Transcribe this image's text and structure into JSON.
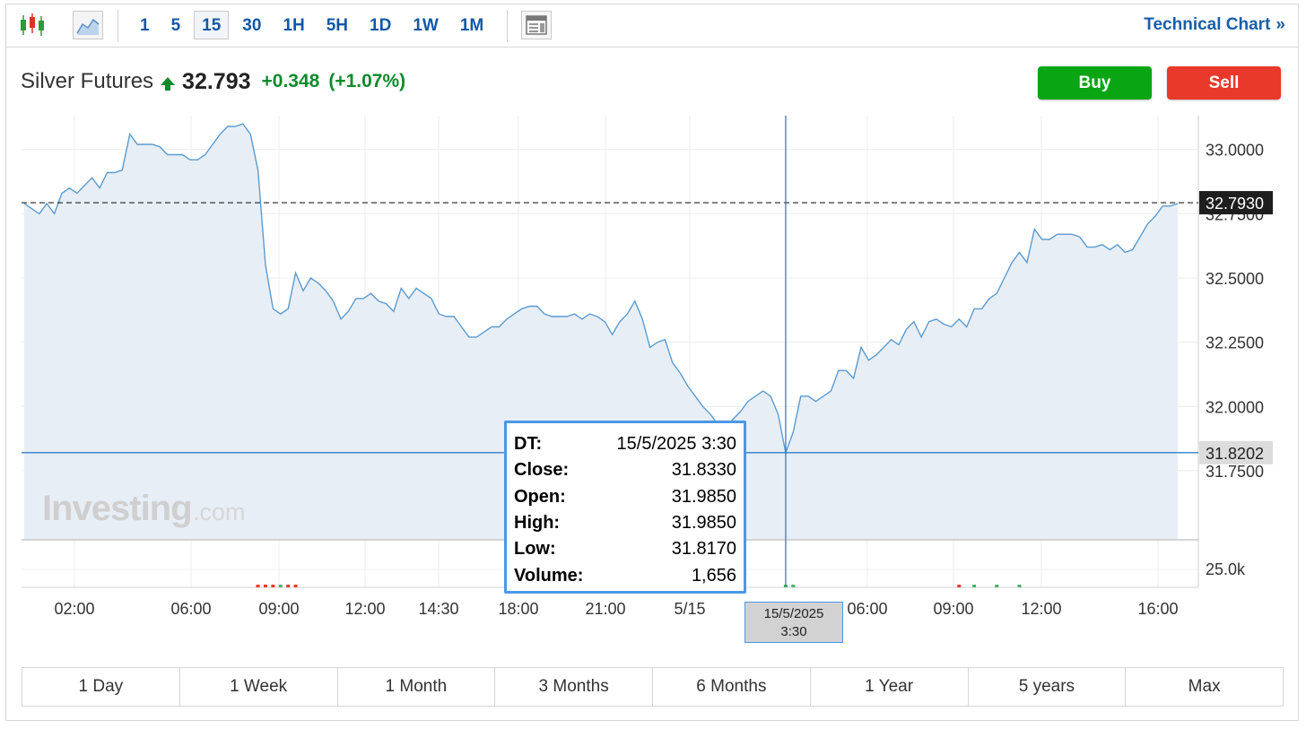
{
  "toolbar": {
    "intervals": [
      "1",
      "5",
      "15",
      "30",
      "1H",
      "5H",
      "1D",
      "1W",
      "1M"
    ],
    "active_interval": "15",
    "technical_chart_label": "Technical Chart",
    "technical_chart_chevron": "»",
    "icons": {
      "candles": "candlestick-icon",
      "area": "area-chart-icon",
      "news": "news-layout-icon"
    }
  },
  "instrument": {
    "name": "Silver Futures",
    "last": "32.793",
    "change": "+0.348",
    "change_pct": "(+1.07%)",
    "direction_icon": "up-arrow-icon"
  },
  "trade": {
    "buy_label": "Buy",
    "sell_label": "Sell"
  },
  "colors": {
    "line": "#5b9bd0",
    "area": "#e8eef6",
    "up": "#0e8a2c",
    "buy": "#0aa513",
    "sell": "#e8392b",
    "link": "#1a5ea8",
    "tooltip_border": "#4c97e9"
  },
  "chart_data": {
    "type": "area",
    "x_labels": [
      "02:00",
      "06:00",
      "09:00",
      "12:00",
      "14:30",
      "18:00",
      "21:00",
      "5/15",
      "06:00",
      "09:00",
      "12:00",
      "16:00"
    ],
    "y_ticks": [
      "33.0000",
      "32.7500",
      "32.5000",
      "32.2500",
      "32.0000",
      "31.7500"
    ],
    "ylim": [
      31.75,
      33.2
    ],
    "volume_tick": "25.0k",
    "last_price_tag": "32.7930",
    "crosshair_price_tag": "31.8202",
    "crosshair_value": 31.8202,
    "last_value": 32.793,
    "crosshair_date": [
      "15/5/2025",
      "3:30"
    ],
    "watermark": {
      "brand": "Investing",
      "suffix": ".com"
    },
    "values": [
      32.79,
      32.77,
      32.75,
      32.79,
      32.75,
      32.83,
      32.85,
      32.83,
      32.86,
      32.89,
      32.85,
      32.91,
      32.91,
      32.92,
      33.06,
      33.02,
      33.02,
      33.02,
      33.01,
      32.98,
      32.98,
      32.98,
      32.96,
      32.96,
      32.98,
      33.02,
      33.06,
      33.09,
      33.09,
      33.1,
      33.06,
      32.92,
      32.55,
      32.38,
      32.36,
      32.38,
      32.52,
      32.45,
      32.5,
      32.48,
      32.45,
      32.41,
      32.34,
      32.37,
      32.42,
      32.42,
      32.44,
      32.41,
      32.4,
      32.37,
      32.46,
      32.42,
      32.46,
      32.44,
      32.42,
      32.36,
      32.35,
      32.35,
      32.31,
      32.27,
      32.27,
      32.29,
      32.31,
      32.31,
      32.34,
      32.36,
      32.38,
      32.39,
      32.39,
      32.36,
      32.35,
      32.35,
      32.35,
      32.36,
      32.34,
      32.36,
      32.35,
      32.33,
      32.28,
      32.33,
      32.36,
      32.41,
      32.34,
      32.23,
      32.25,
      32.26,
      32.17,
      32.13,
      32.08,
      32.04,
      32.0,
      31.97,
      31.93,
      31.92,
      31.95,
      31.98,
      32.02,
      32.04,
      32.06,
      32.04,
      31.97,
      31.82,
      31.9,
      32.04,
      32.04,
      32.02,
      32.04,
      32.06,
      32.14,
      32.14,
      32.11,
      32.23,
      32.18,
      32.2,
      32.23,
      32.26,
      32.24,
      32.3,
      32.33,
      32.27,
      32.33,
      32.34,
      32.32,
      32.31,
      32.34,
      32.31,
      32.38,
      32.38,
      32.42,
      32.44,
      32.5,
      32.56,
      32.6,
      32.56,
      32.69,
      32.65,
      32.65,
      32.67,
      32.67,
      32.67,
      32.66,
      32.62,
      32.62,
      32.63,
      32.61,
      32.63,
      32.6,
      32.61,
      32.66,
      32.71,
      32.74,
      32.78,
      32.78,
      32.79
    ],
    "volume_bars": [
      {
        "i": 31,
        "color": "red"
      },
      {
        "i": 32,
        "color": "red"
      },
      {
        "i": 33,
        "color": "red"
      },
      {
        "i": 34,
        "color": "green"
      },
      {
        "i": 35,
        "color": "red"
      },
      {
        "i": 36,
        "color": "red"
      },
      {
        "i": 101,
        "color": "green"
      },
      {
        "i": 102,
        "color": "green"
      },
      {
        "i": 124,
        "color": "red"
      },
      {
        "i": 126,
        "color": "green"
      },
      {
        "i": 129,
        "color": "green"
      },
      {
        "i": 132,
        "color": "green"
      }
    ]
  },
  "tooltip": {
    "rows": [
      {
        "key": "DT:",
        "value": "15/5/2025 3:30"
      },
      {
        "key": "Close:",
        "value": "31.8330"
      },
      {
        "key": "Open:",
        "value": "31.9850"
      },
      {
        "key": "High:",
        "value": "31.9850"
      },
      {
        "key": "Low:",
        "value": "31.8170"
      },
      {
        "key": "Volume:",
        "value": "1,656"
      }
    ]
  },
  "ranges": [
    "1 Day",
    "1 Week",
    "1 Month",
    "3 Months",
    "6 Months",
    "1 Year",
    "5 years",
    "Max"
  ]
}
